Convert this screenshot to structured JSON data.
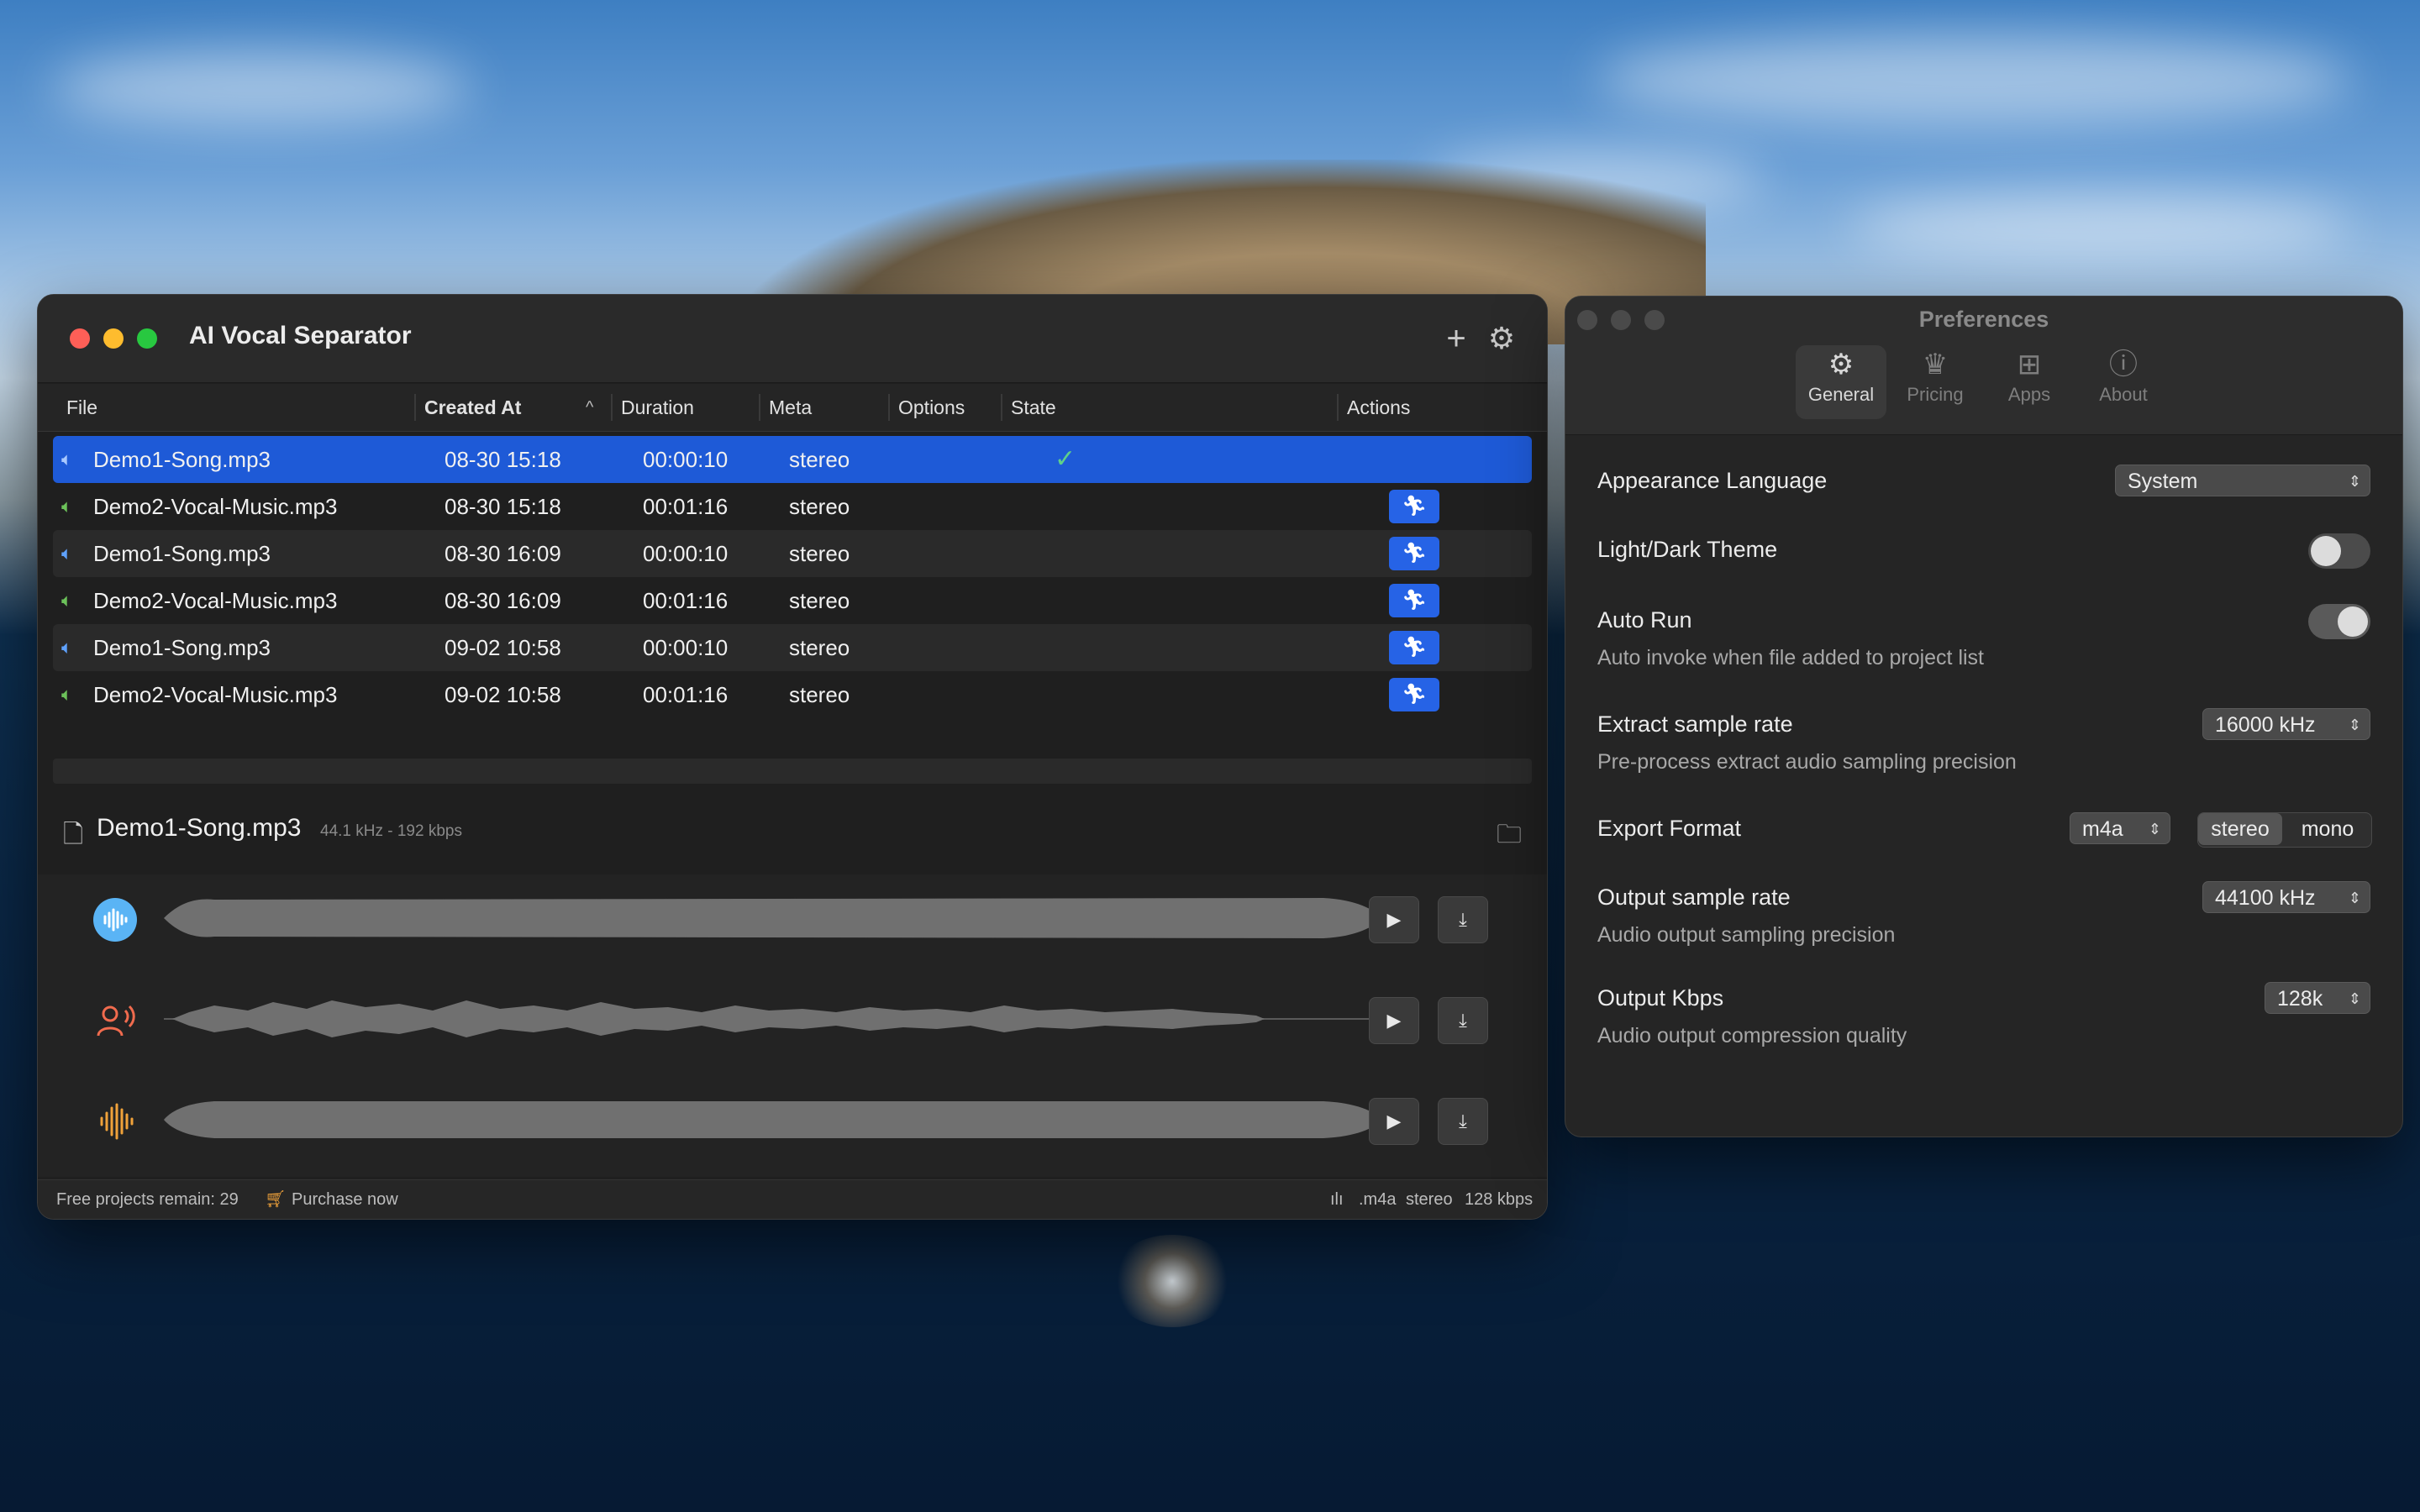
{
  "main_window": {
    "title": "AI Vocal Separator",
    "add_icon": "+",
    "settings_icon": "⚙",
    "columns": [
      "File",
      "Created At",
      "Duration",
      "Meta",
      "Options",
      "State",
      "Actions"
    ],
    "sort_indicator": "^",
    "rows": [
      {
        "file": "Demo1-Song.mp3",
        "created": "08-30 15:18",
        "duration": "00:00:10",
        "meta": "stereo",
        "state": "✓",
        "icon_color": "blue"
      },
      {
        "file": "Demo2-Vocal-Music.mp3",
        "created": "08-30 15:18",
        "duration": "00:01:16",
        "meta": "stereo",
        "state": "",
        "icon_color": "green"
      },
      {
        "file": "Demo1-Song.mp3",
        "created": "08-30 16:09",
        "duration": "00:00:10",
        "meta": "stereo",
        "state": "",
        "icon_color": "blue"
      },
      {
        "file": "Demo2-Vocal-Music.mp3",
        "created": "08-30 16:09",
        "duration": "00:01:16",
        "meta": "stereo",
        "state": "",
        "icon_color": "green"
      },
      {
        "file": "Demo1-Song.mp3",
        "created": "09-02 10:58",
        "duration": "00:00:10",
        "meta": "stereo",
        "state": "",
        "icon_color": "blue"
      },
      {
        "file": "Demo2-Vocal-Music.mp3",
        "created": "09-02 10:58",
        "duration": "00:01:16",
        "meta": "stereo",
        "state": "",
        "icon_color": "green"
      }
    ],
    "selected_file": {
      "name": "Demo1-Song.mp3",
      "meta": "44.1 kHz - 192 kbps"
    },
    "tracks": [
      {
        "kind": "original-waveform-icon",
        "color": "#5ab4f5"
      },
      {
        "kind": "vocal-speaker-icon",
        "color": "#f06b4e"
      },
      {
        "kind": "music-waveform-icon",
        "color": "#f0a23a"
      }
    ],
    "status": {
      "free_projects": "Free projects remain: 29",
      "purchase": "Purchase now",
      "format": ".m4a",
      "channels": "stereo",
      "bitrate": "128 kbps"
    }
  },
  "preferences": {
    "title": "Preferences",
    "tabs": [
      {
        "label": "General",
        "icon": "gear-icon",
        "active": true
      },
      {
        "label": "Pricing",
        "icon": "crown-icon",
        "active": false
      },
      {
        "label": "Apps",
        "icon": "apps-icon",
        "active": false
      },
      {
        "label": "About",
        "icon": "info-icon",
        "active": false
      }
    ],
    "appearance_language": {
      "label": "Appearance Language",
      "value": "System"
    },
    "theme": {
      "label": "Light/Dark Theme",
      "on": false
    },
    "auto_run": {
      "label": "Auto Run",
      "sub": "Auto invoke when file added to project list",
      "on": true
    },
    "extract_rate": {
      "label": "Extract sample rate",
      "value": "16000 kHz",
      "sub": "Pre-process extract audio sampling precision"
    },
    "export_format": {
      "label": "Export Format",
      "format": "m4a",
      "options": [
        "stereo",
        "mono"
      ],
      "selected": "stereo"
    },
    "output_rate": {
      "label": "Output sample rate",
      "value": "44100 kHz",
      "sub": "Audio output sampling precision"
    },
    "output_kbps": {
      "label": "Output Kbps",
      "value": "128k",
      "sub": "Audio output compression quality"
    }
  }
}
